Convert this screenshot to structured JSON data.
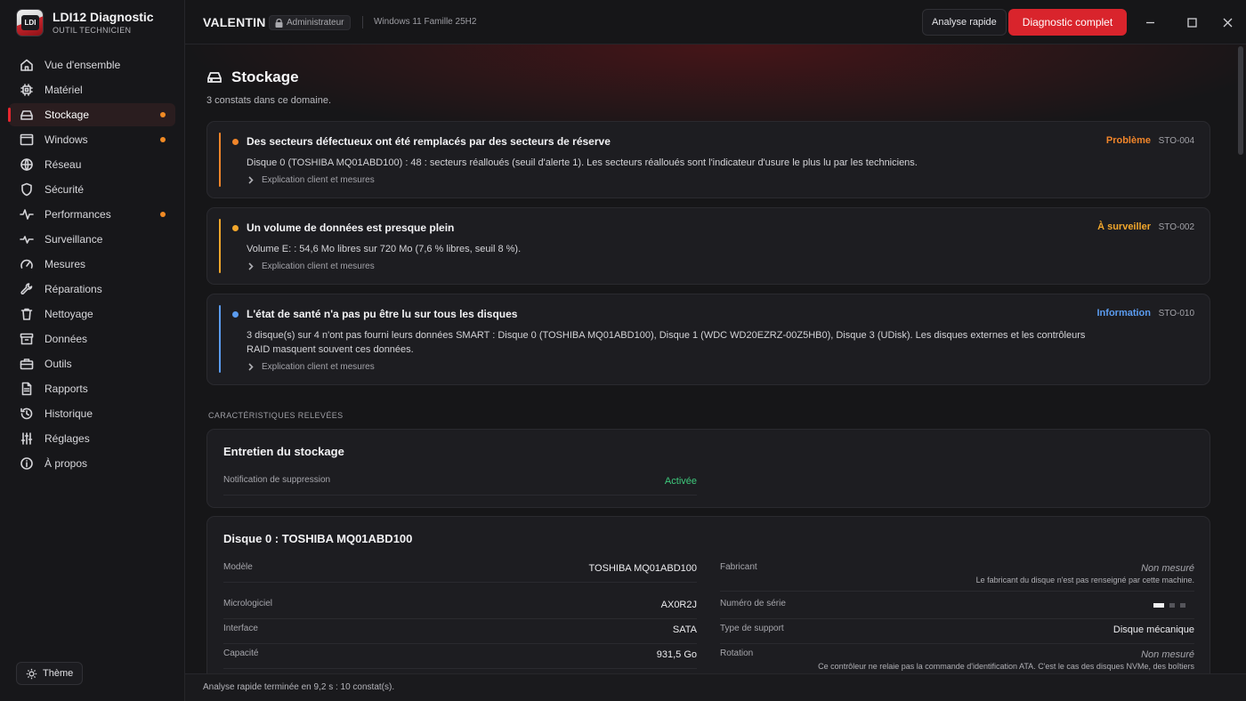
{
  "app": {
    "title": "LDI12 Diagnostic",
    "subtitle": "OUTIL TECHNICIEN",
    "logo_text": "LDI"
  },
  "sidebar": {
    "items": [
      {
        "label": "Vue d'ensemble",
        "icon": "home-icon",
        "active": false,
        "dot": false
      },
      {
        "label": "Matériel",
        "icon": "chip-icon",
        "active": false,
        "dot": false
      },
      {
        "label": "Stockage",
        "icon": "drive-icon",
        "active": true,
        "dot": true
      },
      {
        "label": "Windows",
        "icon": "window-icon",
        "active": false,
        "dot": true
      },
      {
        "label": "Réseau",
        "icon": "globe-icon",
        "active": false,
        "dot": false
      },
      {
        "label": "Sécurité",
        "icon": "shield-icon",
        "active": false,
        "dot": false
      },
      {
        "label": "Performances",
        "icon": "pulse-icon",
        "active": false,
        "dot": true
      },
      {
        "label": "Surveillance",
        "icon": "monitor-pulse-icon",
        "active": false,
        "dot": false
      },
      {
        "label": "Mesures",
        "icon": "gauge-icon",
        "active": false,
        "dot": false
      },
      {
        "label": "Réparations",
        "icon": "wrench-icon",
        "active": false,
        "dot": false
      },
      {
        "label": "Nettoyage",
        "icon": "trash-icon",
        "active": false,
        "dot": false
      },
      {
        "label": "Données",
        "icon": "archive-icon",
        "active": false,
        "dot": false
      },
      {
        "label": "Outils",
        "icon": "toolbox-icon",
        "active": false,
        "dot": false
      },
      {
        "label": "Rapports",
        "icon": "report-icon",
        "active": false,
        "dot": false
      },
      {
        "label": "Historique",
        "icon": "history-icon",
        "active": false,
        "dot": false
      },
      {
        "label": "Réglages",
        "icon": "sliders-icon",
        "active": false,
        "dot": false
      },
      {
        "label": "À propos",
        "icon": "info-icon",
        "active": false,
        "dot": false
      }
    ],
    "theme_label": "Thème"
  },
  "topbar": {
    "machine": "VALENTIN",
    "role": "Administrateur",
    "os": "Windows 11 Famille 25H2",
    "quick_label": "Analyse rapide",
    "full_label": "Diagnostic complet"
  },
  "page": {
    "title": "Stockage",
    "subtitle": "3 constats dans ce domaine.",
    "section_label": "CARACTÉRISTIQUES RELEVÉES"
  },
  "findings": [
    {
      "title": "Des secteurs défectueux ont été remplacés par des secteurs de réserve",
      "severity": "Problème",
      "code": "STO-004",
      "text": "Disque 0 (TOSHIBA MQ01ABD100) : 48 : secteurs réalloués (seuil d'alerte 1). Les secteurs réalloués sont l'indicateur d'usure le plus lu par les techniciens.",
      "explain": "Explication client et mesures",
      "color": "#f0852a"
    },
    {
      "title": "Un volume de données est presque plein",
      "severity": "À surveiller",
      "code": "STO-002",
      "text": "Volume E: : 54,6 Mo libres sur 720 Mo (7,6 % libres, seuil 8 %).",
      "explain": "Explication client et mesures",
      "color": "#f2a72c"
    },
    {
      "title": "L'état de santé n'a pas pu être lu sur tous les disques",
      "severity": "Information",
      "code": "STO-010",
      "text": "3 disque(s) sur 4 n'ont pas fourni leurs données SMART : Disque 0 (TOSHIBA MQ01ABD100), Disque 1 (WDC WD20EZRZ-00Z5HB0), Disque 3 (UDisk). Les disques externes et les contrôleurs RAID masquent souvent ces données.",
      "explain": "Explication client et mesures",
      "color": "#5b9cf0"
    }
  ],
  "maintenance": {
    "title": "Entretien du stockage",
    "key": "Notification de suppression",
    "value": "Activée",
    "value_color": "#3ec97c"
  },
  "disk": {
    "title": "Disque 0 : TOSHIBA MQ01ABD100",
    "left": [
      {
        "key": "Modèle",
        "value": "TOSHIBA MQ01ABD100"
      },
      {
        "key": "Micrologiciel",
        "value": "AX0R2J"
      },
      {
        "key": "Interface",
        "value": "SATA"
      },
      {
        "key": "Capacité",
        "value": "931,5 Go"
      }
    ],
    "right": [
      {
        "key": "Fabricant",
        "value": "Non mesuré",
        "note": "Le fabricant du disque n'est pas renseigné par cette machine."
      },
      {
        "key": "Numéro de série",
        "value": "",
        "masked": true
      },
      {
        "key": "Type de support",
        "value": "Disque mécanique"
      },
      {
        "key": "Rotation",
        "value": "Non mesuré",
        "note": "Ce contrôleur ne relaie pas la commande d'identification ATA. C'est le cas des disques NVMe, des boîtiers"
      }
    ]
  },
  "status": {
    "text": "Analyse rapide terminée en 9,2 s : 10 constat(s)."
  }
}
